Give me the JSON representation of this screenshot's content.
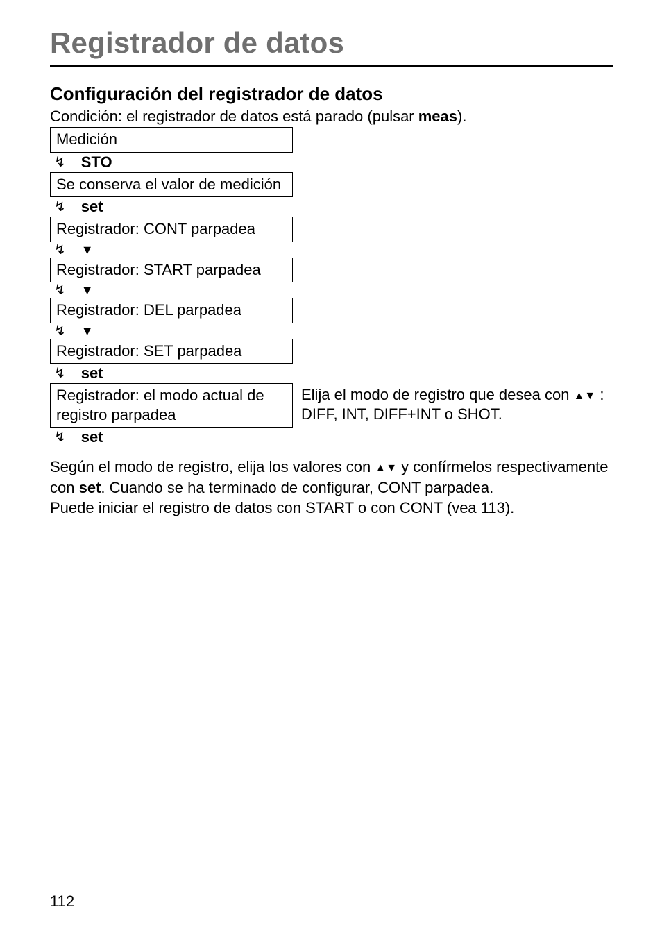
{
  "title": "Registrador de datos",
  "subheading": "Configuración del registrador de datos",
  "condition_pre": "Condición: el registrador de datos está parado (pulsar ",
  "condition_bold": "meas",
  "condition_post": ").",
  "boxes": {
    "medicion": "Medición",
    "conserva": "Se conserva el valor de medición",
    "cont": "Registrador: CONT parpadea",
    "start": "Registrador: START parpadea",
    "del": "Registrador: DEL parpadea",
    "setp": "Registrador: SET parpadea",
    "modo": "Registrador: el modo actual de registro parpadea"
  },
  "steps": {
    "sto": "STO",
    "set": "set"
  },
  "mode_right_pre": "Elija el modo de registro que desea con ",
  "mode_right_post": " : DIFF, INT, DIFF+INT o SHOT.",
  "para_pre": "Según el modo de registro, elija los valores con ",
  "para_mid1": " y confírmelos respectivamente con ",
  "para_set": "set",
  "para_mid2": ". Cuando se ha terminado de configurar, CONT parpadea.",
  "para_line2": "Puede iniciar el registro de datos con START o con CONT (vea 113).",
  "page_num": "112"
}
